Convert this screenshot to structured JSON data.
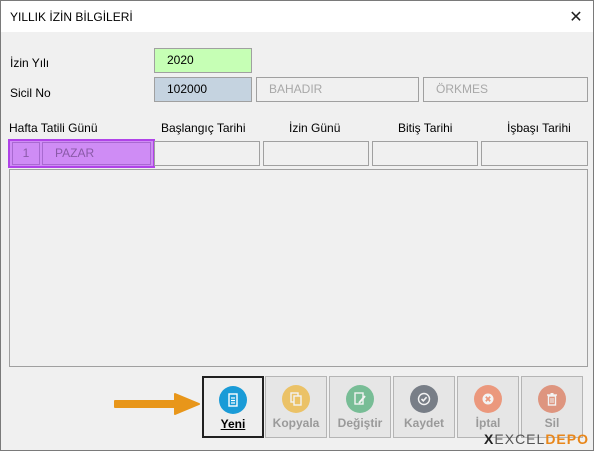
{
  "window": {
    "title": "YILLIK İZİN BİLGİLERİ",
    "close_glyph": "✕"
  },
  "form": {
    "izin_yili_label": "İzin Yılı",
    "izin_yili_value": "2020",
    "sicil_no_label": "Sicil No",
    "sicil_no_value": "102000",
    "first_name_value": "BAHADIR",
    "last_name_value": "ÖRKMES"
  },
  "table": {
    "headers": [
      "Hafta Tatili Günü",
      "Başlangıç Tarihi",
      "İzin Günü",
      "Bitiş Tarihi",
      "İşbaşı Tarihi"
    ],
    "row": {
      "number": "1",
      "day": "PAZAR",
      "start": "",
      "days": "",
      "end": "",
      "return": ""
    }
  },
  "buttons": [
    {
      "label": "Yeni",
      "icon": "document-icon",
      "color": "#1a9bd7",
      "state": "active"
    },
    {
      "label": "Kopyala",
      "icon": "copy-icon",
      "color": "#f0a500",
      "state": "disabled"
    },
    {
      "label": "Değiştir",
      "icon": "edit-icon",
      "color": "#1f9d55",
      "state": "disabled"
    },
    {
      "label": "Kaydet",
      "icon": "check-icon",
      "color": "#1f2a3a",
      "state": "disabled"
    },
    {
      "label": "İptal",
      "icon": "cancel-icon",
      "color": "#f05a28",
      "state": "disabled"
    },
    {
      "label": "Sil",
      "icon": "trash-icon",
      "color": "#d9532c",
      "state": "disabled"
    }
  ],
  "pointer": {
    "icon": "arrow-right-icon",
    "color": "#e8961a"
  },
  "watermark": {
    "x": "X",
    "excel": "EXCEL",
    "depo": "DEPO"
  }
}
